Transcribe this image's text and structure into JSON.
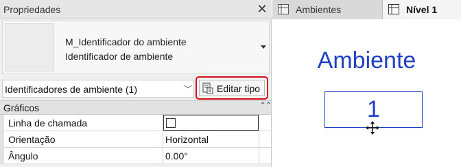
{
  "properties_panel": {
    "title": "Propriedades",
    "type_selector": {
      "family": "M_Identificador do ambiente",
      "type": "Identificador de ambiente"
    },
    "instance_filter": "Identificadores de ambiente (1)",
    "edit_type_label": "Editar tipo",
    "group": {
      "name": "Gráficos",
      "rows": [
        {
          "label": "Linha de chamada",
          "value": "",
          "checked": false
        },
        {
          "label": "Orientação",
          "value": "Horizontal"
        },
        {
          "label": "Ângulo",
          "value": "0.00°"
        }
      ]
    }
  },
  "view_tabs": [
    {
      "label": "Ambientes",
      "active": false
    },
    {
      "label": "Nível 1",
      "active": true
    }
  ],
  "canvas": {
    "room_name": "Ambiente",
    "room_number": "1"
  },
  "colors": {
    "annotation": "#1f3fc4",
    "highlight": "#d0101a"
  }
}
